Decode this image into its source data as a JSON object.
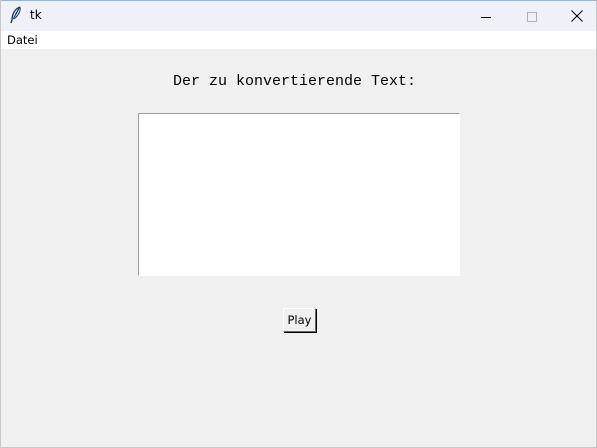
{
  "window": {
    "title": "tk",
    "icon": "tk-feather-icon",
    "controls": {
      "minimize_icon": "minimize-icon",
      "maximize_icon": "maximize-icon",
      "close_icon": "close-icon"
    }
  },
  "menubar": {
    "items": [
      {
        "label": "Datei"
      }
    ]
  },
  "main": {
    "prompt_label": "Der zu konvertierende Text:",
    "text_input": {
      "value": "",
      "placeholder": ""
    },
    "play_button_label": "Play"
  },
  "colors": {
    "window_background": "#f0f0f0",
    "titlebar_background": "#eef2f8",
    "menubar_background": "#ffffff",
    "text_area_background": "#ffffff"
  }
}
